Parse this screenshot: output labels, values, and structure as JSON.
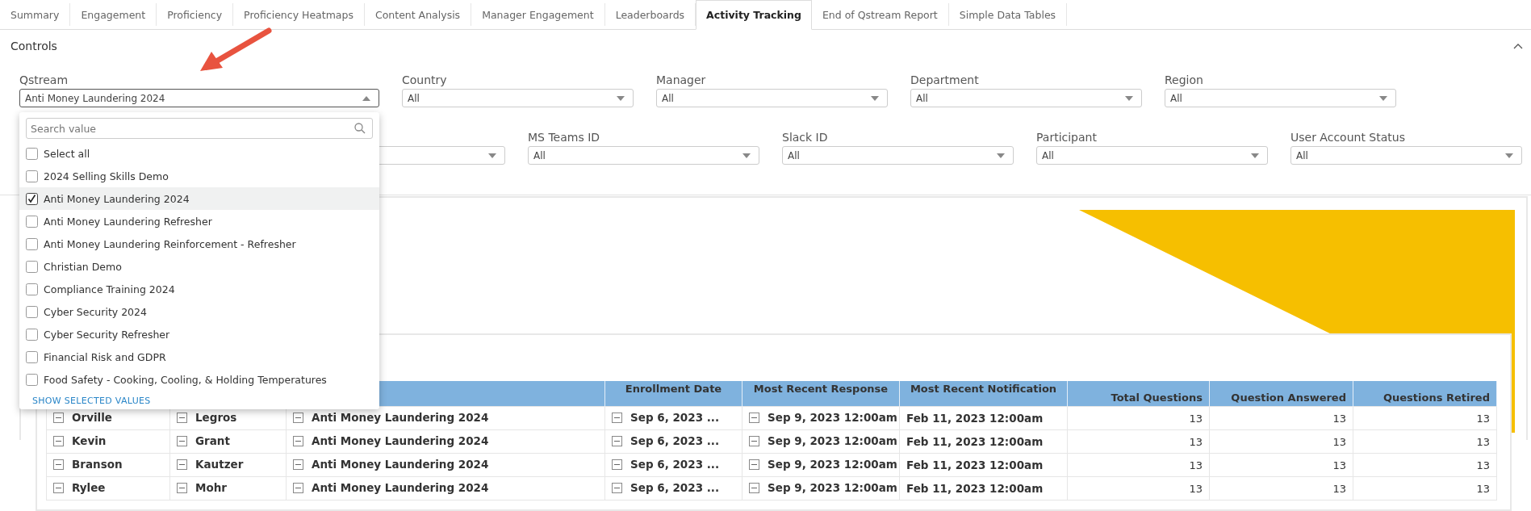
{
  "tabs": [
    {
      "label": "Summary",
      "selected": false
    },
    {
      "label": "Engagement",
      "selected": false
    },
    {
      "label": "Proficiency",
      "selected": false
    },
    {
      "label": "Proficiency Heatmaps",
      "selected": false
    },
    {
      "label": "Content Analysis",
      "selected": false
    },
    {
      "label": "Manager Engagement",
      "selected": false
    },
    {
      "label": "Leaderboards",
      "selected": false
    },
    {
      "label": "Activity Tracking",
      "selected": true
    },
    {
      "label": "End of Qstream Report",
      "selected": false
    },
    {
      "label": "Simple Data Tables",
      "selected": false
    }
  ],
  "controls": {
    "title": "Controls",
    "filters_row_1": [
      {
        "label": "Qstream",
        "value": "Anti Money Laundering 2024",
        "open": true
      },
      {
        "label": "Country",
        "value": "All",
        "open": false
      },
      {
        "label": "Manager",
        "value": "All",
        "open": false
      },
      {
        "label": "Department",
        "value": "All",
        "open": false
      },
      {
        "label": "Region",
        "value": "All",
        "open": false
      }
    ],
    "filters_row_2": [
      {
        "label": "MS Teams ID",
        "value": "All"
      },
      {
        "label": "Slack ID",
        "value": "All"
      },
      {
        "label": "Participant",
        "value": "All"
      },
      {
        "label": "User Account Status",
        "value": "All"
      }
    ]
  },
  "dropdown": {
    "placeholder": "Search value",
    "options": [
      {
        "label": "Select all",
        "checked": false,
        "selected": false
      },
      {
        "label": "2024 Selling Skills Demo",
        "checked": false,
        "selected": false
      },
      {
        "label": "Anti Money Laundering 2024",
        "checked": true,
        "selected": true
      },
      {
        "label": "Anti Money Laundering Refresher",
        "checked": false,
        "selected": false
      },
      {
        "label": "Anti Money Laundering Reinforcement - Refresher",
        "checked": false,
        "selected": false
      },
      {
        "label": "Christian Demo",
        "checked": false,
        "selected": false
      },
      {
        "label": "Compliance Training 2024",
        "checked": false,
        "selected": false
      },
      {
        "label": "Cyber Security 2024",
        "checked": false,
        "selected": false
      },
      {
        "label": "Cyber Security Refresher",
        "checked": false,
        "selected": false
      },
      {
        "label": "Financial Risk and GDPR",
        "checked": false,
        "selected": false
      },
      {
        "label": "Food Safety - Cooking, Cooling, & Holding Temperatures",
        "checked": false,
        "selected": false
      }
    ],
    "footer_link": "SHOW SELECTED VALUES"
  },
  "table": {
    "columns": [
      "",
      "",
      "",
      "Enrollment Date",
      "Most Recent Response",
      "Most Recent Notification",
      "Total Questions",
      "Question Answered",
      "Questions Retired"
    ],
    "rows": [
      [
        "Orville",
        "Legros",
        "Anti Money Laundering 2024",
        "Sep 6, 2023 ...",
        "Sep 9, 2023 12:00am",
        "Feb 11, 2023 12:00am",
        "13",
        "13",
        "13"
      ],
      [
        "Kevin",
        "Grant",
        "Anti Money Laundering 2024",
        "Sep 6, 2023 ...",
        "Sep 9, 2023 12:00am",
        "Feb 11, 2023 12:00am",
        "13",
        "13",
        "13"
      ],
      [
        "Branson",
        "Kautzer",
        "Anti Money Laundering 2024",
        "Sep 6, 2023 ...",
        "Sep 9, 2023 12:00am",
        "Feb 11, 2023 12:00am",
        "13",
        "13",
        "13"
      ],
      [
        "Rylee",
        "Mohr",
        "Anti Money Laundering 2024",
        "Sep 6, 2023 ...",
        "Sep 9, 2023 12:00am",
        "Feb 11, 2023 12:00am",
        "13",
        "13",
        "13"
      ]
    ]
  }
}
